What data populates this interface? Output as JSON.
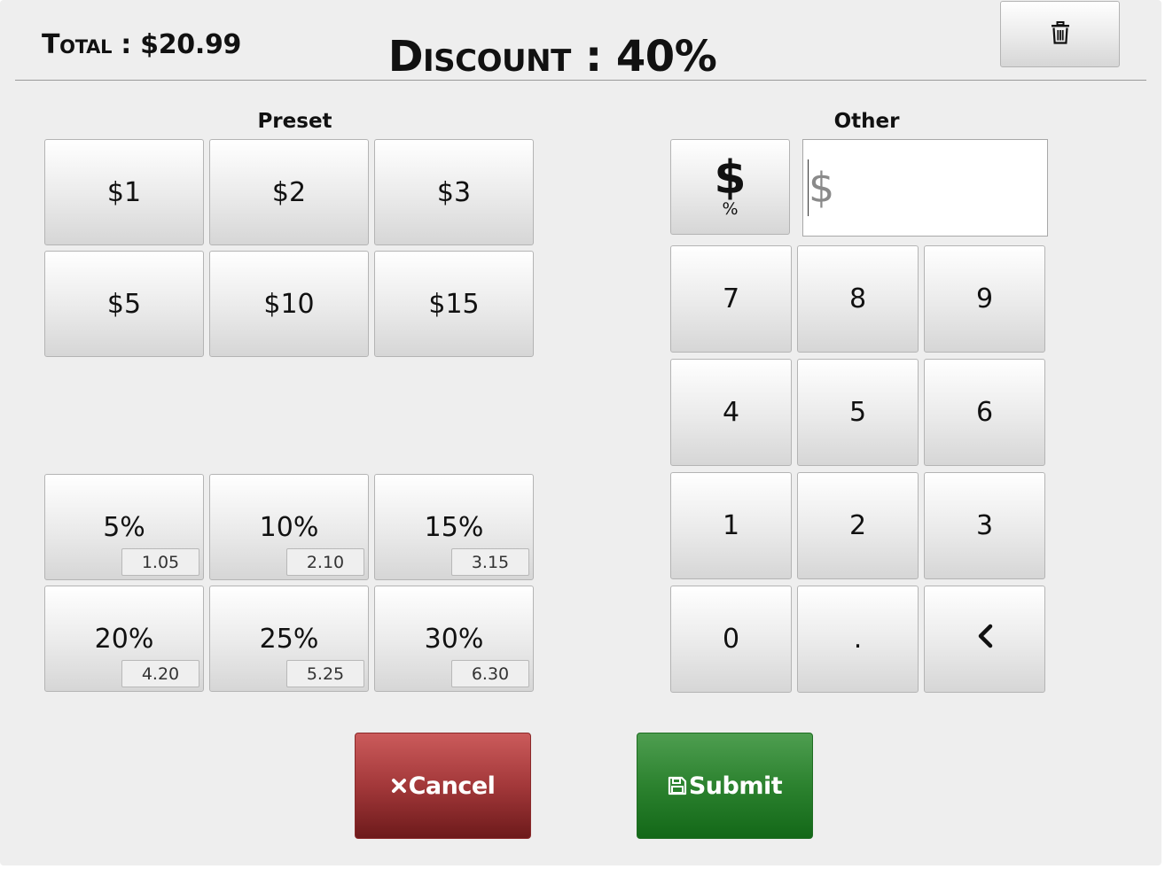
{
  "header": {
    "total_label": "Total : $20.99",
    "discount_label": "Discount : 40%",
    "clear_icon": "trash-icon"
  },
  "preset": {
    "label": "Preset",
    "amount_buttons": [
      "$1",
      "$2",
      "$3",
      "$5",
      "$10",
      "$15"
    ],
    "percent_buttons": [
      {
        "label": "5%",
        "amount": "1.05"
      },
      {
        "label": "10%",
        "amount": "2.10"
      },
      {
        "label": "15%",
        "amount": "3.15"
      },
      {
        "label": "20%",
        "amount": "4.20"
      },
      {
        "label": "25%",
        "amount": "5.25"
      },
      {
        "label": "30%",
        "amount": "6.30"
      }
    ]
  },
  "other": {
    "label": "Other",
    "toggle_main": "$",
    "toggle_sub": "%",
    "input_placeholder": "$",
    "input_value": "",
    "keypad": [
      "7",
      "8",
      "9",
      "4",
      "5",
      "6",
      "1",
      "2",
      "3",
      "0",
      ".",
      "backspace"
    ],
    "backspace_icon": "chevron-left-icon"
  },
  "actions": {
    "cancel_label": "Cancel",
    "cancel_icon": "close-icon",
    "submit_label": "Submit",
    "submit_icon": "save-icon"
  },
  "colors": {
    "cancel": "#a3383a",
    "submit": "#2c822f",
    "panel": "#eeeeee"
  }
}
